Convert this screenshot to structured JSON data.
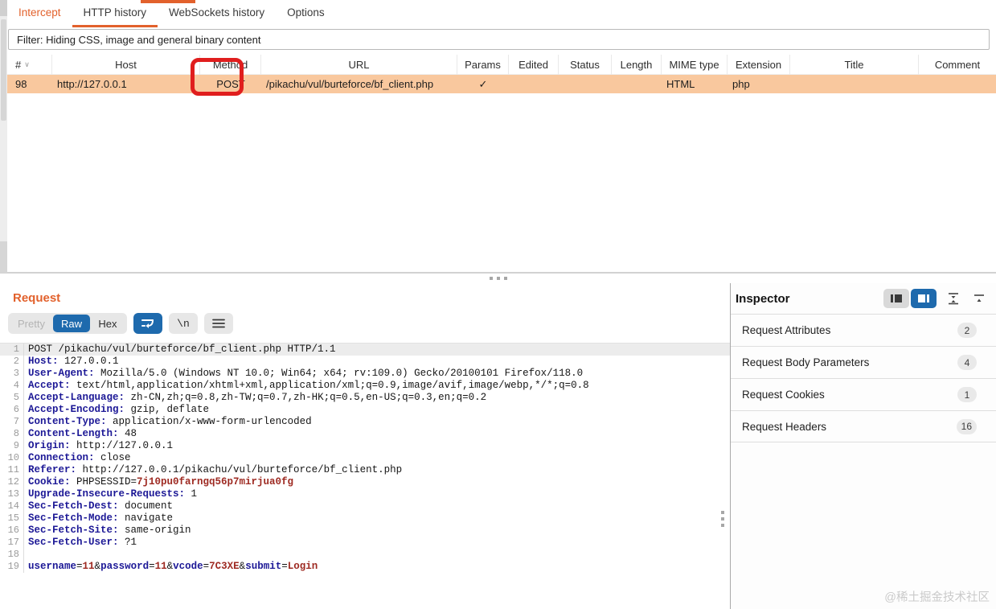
{
  "colors": {
    "orange": "#e2612c",
    "blue": "#1e6aad",
    "row_peach": "#f9c89e",
    "annotation_red": "#e01e1e",
    "header_navy": "#1c1896",
    "value_red": "#9e2a22"
  },
  "tabs": [
    {
      "label": "Intercept",
      "active": false,
      "orange_text": true
    },
    {
      "label": "HTTP history",
      "active": true,
      "orange_text": false
    },
    {
      "label": "WebSockets history",
      "active": false,
      "orange_text": false
    },
    {
      "label": "Options",
      "active": false,
      "orange_text": false
    }
  ],
  "filter": {
    "text": "Filter: Hiding CSS, image and general binary content"
  },
  "table": {
    "columns": [
      "#",
      "Host",
      "Method",
      "URL",
      "Params",
      "Edited",
      "Status",
      "Length",
      "MIME type",
      "Extension",
      "Title",
      "Comment"
    ],
    "row": [
      "98",
      "http://127.0.0.1",
      "POST",
      "/pikachu/vul/burteforce/bf_client.php",
      "✓",
      "",
      "",
      "",
      "HTML",
      "php",
      "",
      ""
    ]
  },
  "request": {
    "title": "Request",
    "toolbar": {
      "pretty": "Pretty",
      "raw": "Raw",
      "hex": "Hex",
      "newline": "\\n"
    },
    "lines": [
      {
        "n": "1",
        "selected": true,
        "seg": [
          [
            "POST /pikachu/vul/burteforce/bf_client.php HTTP/1.1",
            "p"
          ]
        ]
      },
      {
        "n": "2",
        "seg": [
          [
            "Host:",
            "h"
          ],
          [
            " 127.0.0.1",
            "p"
          ]
        ]
      },
      {
        "n": "3",
        "seg": [
          [
            "User-Agent:",
            "h"
          ],
          [
            " Mozilla/5.0 (Windows NT 10.0; Win64; x64; rv:109.0) Gecko/20100101 Firefox/118.0",
            "p"
          ]
        ]
      },
      {
        "n": "4",
        "seg": [
          [
            "Accept:",
            "h"
          ],
          [
            " text/html,application/xhtml+xml,application/xml;q=0.9,image/avif,image/webp,*/*;q=0.8",
            "p"
          ]
        ]
      },
      {
        "n": "5",
        "seg": [
          [
            "Accept-Language:",
            "h"
          ],
          [
            " zh-CN,zh;q=0.8,zh-TW;q=0.7,zh-HK;q=0.5,en-US;q=0.3,en;q=0.2",
            "p"
          ]
        ]
      },
      {
        "n": "6",
        "seg": [
          [
            "Accept-Encoding:",
            "h"
          ],
          [
            " gzip, deflate",
            "p"
          ]
        ]
      },
      {
        "n": "7",
        "seg": [
          [
            "Content-Type:",
            "h"
          ],
          [
            " application/x-www-form-urlencoded",
            "p"
          ]
        ]
      },
      {
        "n": "8",
        "seg": [
          [
            "Content-Length:",
            "h"
          ],
          [
            " 48",
            "p"
          ]
        ]
      },
      {
        "n": "9",
        "seg": [
          [
            "Origin:",
            "h"
          ],
          [
            " http://127.0.0.1",
            "p"
          ]
        ]
      },
      {
        "n": "10",
        "seg": [
          [
            "Connection:",
            "h"
          ],
          [
            " close",
            "p"
          ]
        ]
      },
      {
        "n": "11",
        "seg": [
          [
            "Referer:",
            "h"
          ],
          [
            " http://127.0.0.1/pikachu/vul/burteforce/bf_client.php",
            "p"
          ]
        ]
      },
      {
        "n": "12",
        "seg": [
          [
            "Cookie:",
            "h"
          ],
          [
            " PHPSESSID=",
            "p"
          ],
          [
            "7j10pu0farngq56p7mirjua0fg",
            "v"
          ]
        ]
      },
      {
        "n": "13",
        "seg": [
          [
            "Upgrade-Insecure-Requests:",
            "h"
          ],
          [
            " 1",
            "p"
          ]
        ]
      },
      {
        "n": "14",
        "seg": [
          [
            "Sec-Fetch-Dest:",
            "h"
          ],
          [
            " document",
            "p"
          ]
        ]
      },
      {
        "n": "15",
        "seg": [
          [
            "Sec-Fetch-Mode:",
            "h"
          ],
          [
            " navigate",
            "p"
          ]
        ]
      },
      {
        "n": "16",
        "seg": [
          [
            "Sec-Fetch-Site:",
            "h"
          ],
          [
            " same-origin",
            "p"
          ]
        ]
      },
      {
        "n": "17",
        "seg": [
          [
            "Sec-Fetch-User:",
            "h"
          ],
          [
            " ?1",
            "p"
          ]
        ]
      },
      {
        "n": "18",
        "seg": []
      },
      {
        "n": "19",
        "seg": [
          [
            "username",
            "h"
          ],
          [
            "=",
            "p"
          ],
          [
            "11",
            "v"
          ],
          [
            "&",
            "p"
          ],
          [
            "password",
            "h"
          ],
          [
            "=",
            "p"
          ],
          [
            "11",
            "v"
          ],
          [
            "&",
            "p"
          ],
          [
            "vcode",
            "h"
          ],
          [
            "=",
            "p"
          ],
          [
            "7C3XE",
            "v"
          ],
          [
            "&",
            "p"
          ],
          [
            "submit",
            "h"
          ],
          [
            "=",
            "p"
          ],
          [
            "Login",
            "v"
          ]
        ]
      }
    ]
  },
  "inspector": {
    "title": "Inspector",
    "sections": [
      {
        "label": "Request Attributes",
        "count": "2"
      },
      {
        "label": "Request Body Parameters",
        "count": "4"
      },
      {
        "label": "Request Cookies",
        "count": "1"
      },
      {
        "label": "Request Headers",
        "count": "16"
      }
    ]
  },
  "watermark": "@稀土掘金技术社区"
}
